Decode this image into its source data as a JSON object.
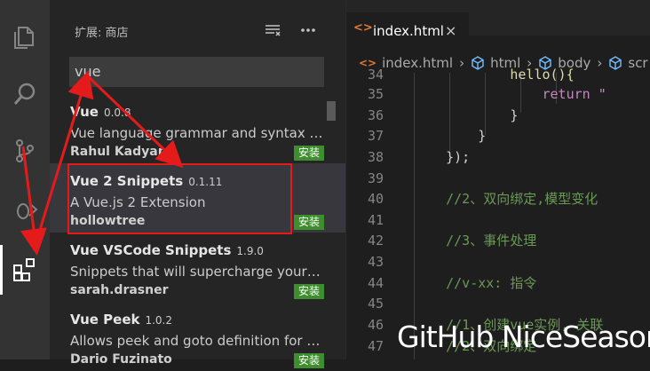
{
  "sidebar": {
    "title": "扩展: 商店",
    "search_value": "vue",
    "icons": [
      "clear-extensions-icon",
      "more-actions-icon"
    ]
  },
  "extensions": [
    {
      "name": "Vue",
      "version": "0.0.8",
      "description": "Vue language grammar and syntax hi...",
      "author": "Rahul Kadyan",
      "install_label": "安装"
    },
    {
      "name": "Vue 2 Snippets",
      "version": "0.1.11",
      "description": "A Vue.js 2 Extension",
      "author": "hollowtree",
      "install_label": "安装"
    },
    {
      "name": "Vue VSCode Snippets",
      "version": "1.9.0",
      "description": "Snippets that will supercharge your V...",
      "author": "sarah.drasner",
      "install_label": "安装"
    },
    {
      "name": "Vue Peek",
      "version": "1.0.2",
      "description": "Allows peek and goto definition for V...",
      "author": "Dario Fuzinato",
      "install_label": "安装"
    }
  ],
  "editor": {
    "tab": {
      "icon": "<>",
      "label": "index.html",
      "close": "×"
    },
    "breadcrumb": [
      "index.html",
      "html",
      "body",
      "scr"
    ],
    "lines": [
      {
        "n": "34",
        "code": "            hello(){"
      },
      {
        "n": "35",
        "code": "                return \""
      },
      {
        "n": "36",
        "code": "            }"
      },
      {
        "n": "37",
        "code": "        }"
      },
      {
        "n": "38",
        "code": "    });"
      },
      {
        "n": "39",
        "code": ""
      },
      {
        "n": "40",
        "code": "    //2、双向绑定,模型变化"
      },
      {
        "n": "41",
        "code": ""
      },
      {
        "n": "42",
        "code": "    //3、事件处理"
      },
      {
        "n": "43",
        "code": ""
      },
      {
        "n": "44",
        "code": "    //v-xx: 指令"
      },
      {
        "n": "45",
        "code": ""
      },
      {
        "n": "46",
        "code": "    //1、创建vue实例, 关联"
      },
      {
        "n": "47",
        "code": "    //2、双向绑定"
      }
    ]
  },
  "watermark": "GitHub NiceSeason",
  "colors": {
    "accent_red": "#e51b1b",
    "install_green": "#3e8e2f",
    "comment_green": "#6a9955",
    "keyword_purple": "#c586c0",
    "string_orange": "#ce9178"
  }
}
